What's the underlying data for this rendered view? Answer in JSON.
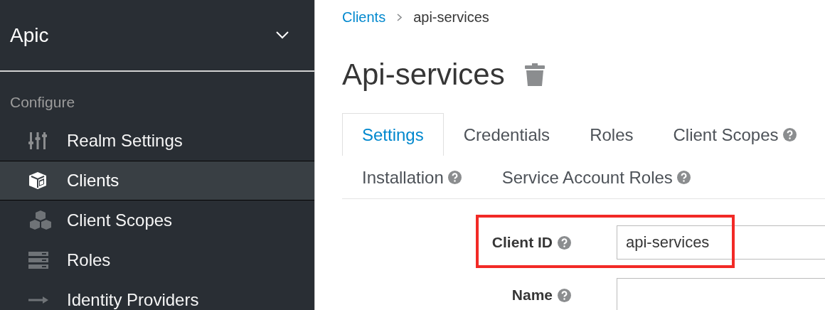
{
  "realm": {
    "name": "Apic"
  },
  "sidebar": {
    "section": "Configure",
    "items": [
      {
        "label": "Realm Settings",
        "selected": false
      },
      {
        "label": "Clients",
        "selected": true
      },
      {
        "label": "Client Scopes",
        "selected": false
      },
      {
        "label": "Roles",
        "selected": false
      },
      {
        "label": "Identity Providers",
        "selected": false
      }
    ]
  },
  "breadcrumb": [
    {
      "label": "Clients",
      "kind": "link"
    },
    {
      "label": "api-services",
      "kind": "current"
    }
  ],
  "page_title": "Api-services",
  "tab_rows": [
    [
      {
        "label": "Settings",
        "selected": true,
        "help": false
      },
      {
        "label": "Credentials",
        "selected": false,
        "help": false
      },
      {
        "label": "Roles",
        "selected": false,
        "help": false
      },
      {
        "label": "Client Scopes",
        "selected": false,
        "help": true
      }
    ],
    [
      {
        "label": "Installation",
        "selected": false,
        "help": true
      },
      {
        "label": "Service Account Roles",
        "selected": false,
        "help": true
      }
    ]
  ],
  "fields": [
    {
      "label": "Client ID",
      "value": "api-services",
      "highlighted": true
    },
    {
      "label": "Name",
      "highlighted": false
    }
  ]
}
